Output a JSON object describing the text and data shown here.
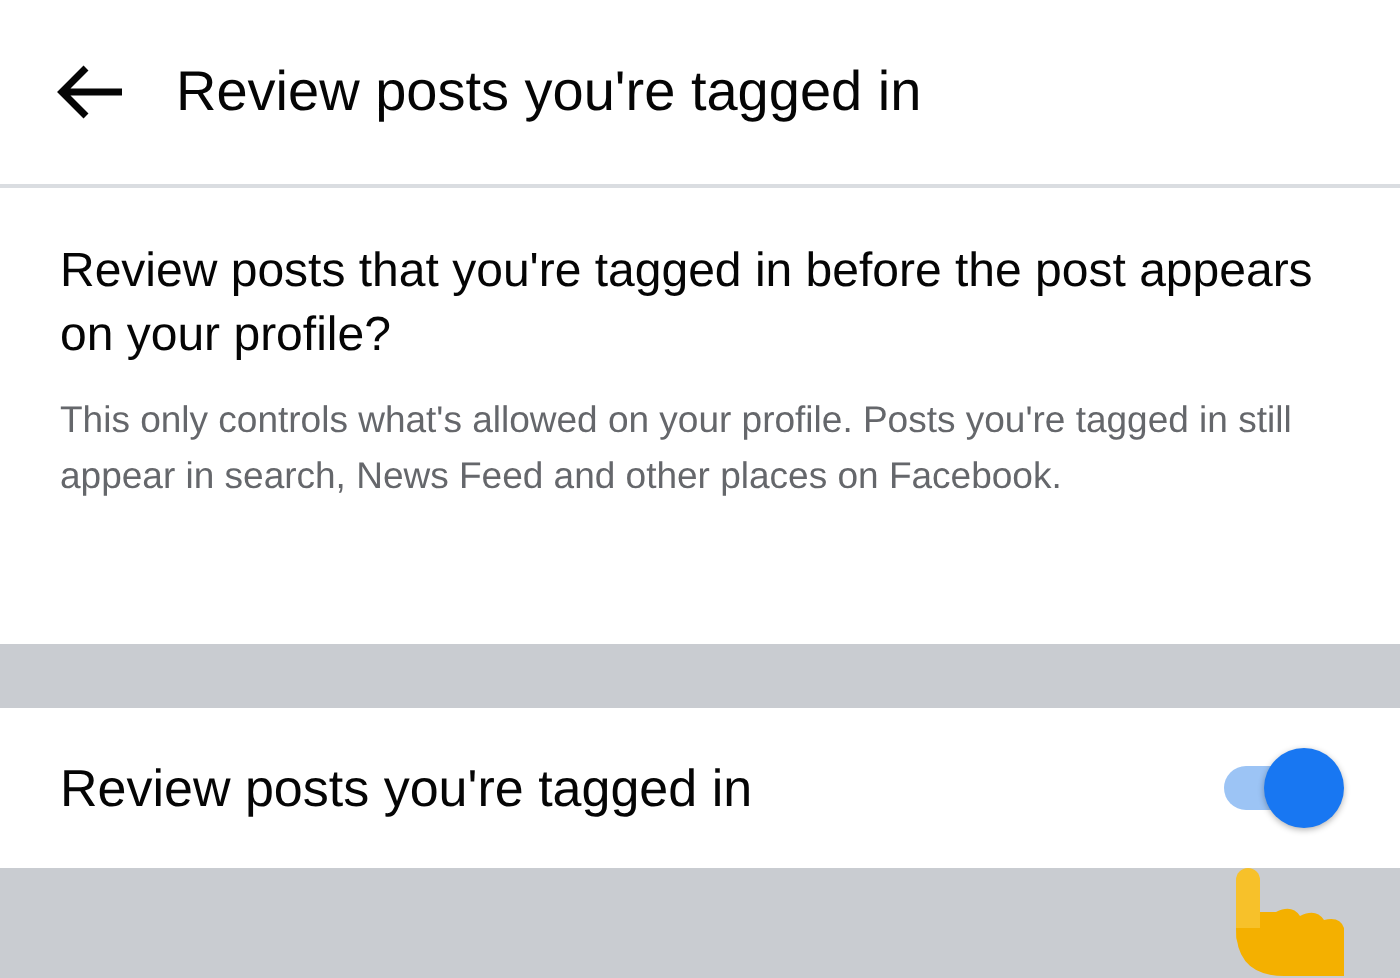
{
  "header": {
    "title": "Review posts you're tagged in"
  },
  "intro": {
    "question": "Review posts that you're tagged in before the post appears on your profile?",
    "description": "This only controls what's allowed on your profile. Posts you're tagged in still appear in search, News Feed and other places on Facebook."
  },
  "setting": {
    "label": "Review posts you're tagged in",
    "on": true
  }
}
